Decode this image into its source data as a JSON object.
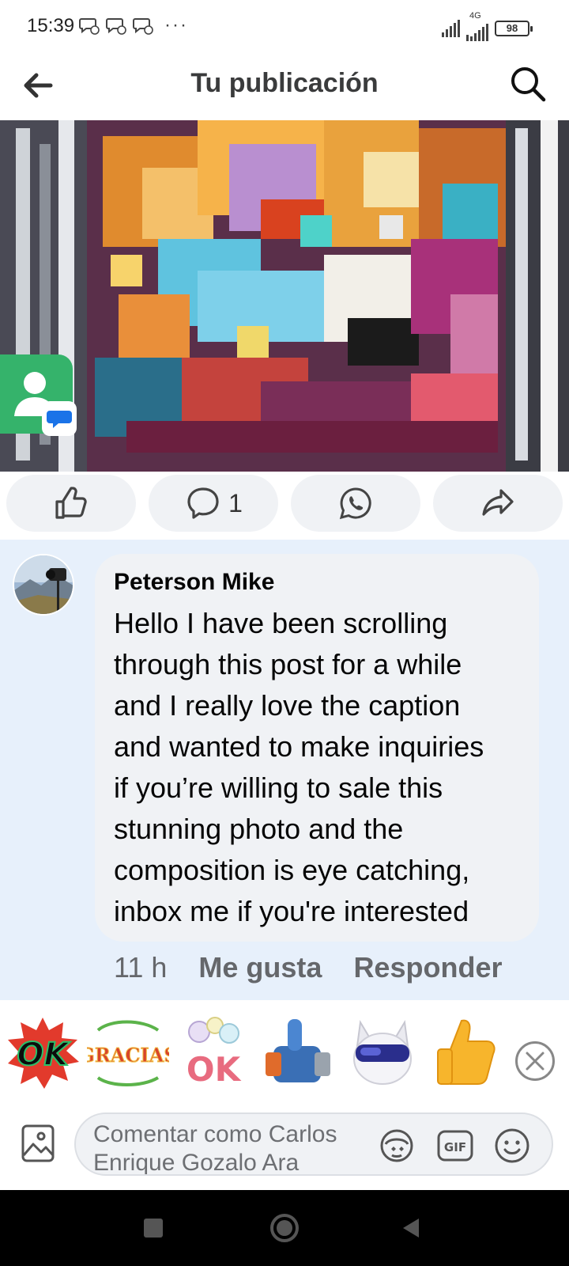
{
  "status_bar": {
    "time": "15:39",
    "more": "···",
    "network": "4G",
    "battery": "98"
  },
  "header": {
    "title": "Tu publicación"
  },
  "post_actions": {
    "comment_count": "1"
  },
  "comment": {
    "author": "Peterson Mike",
    "text": "Hello I have been scrolling\nthrough this post for a while\nand I really love the caption\nand wanted to make inquiries\nif you’re willing to sale this\nstunning photo and the\ncomposition is eye catching,\ninbox me if you're interested",
    "time": "11 h",
    "like_label": "Me gusta",
    "reply_label": "Responder"
  },
  "stickers": [
    {
      "name": "ok-sticker",
      "text": "OK"
    },
    {
      "name": "gracias-sticker",
      "text": "GRACIAS"
    },
    {
      "name": "cute-ok-sticker",
      "text": "OK"
    },
    {
      "name": "robot-thumbs-sticker",
      "text": ""
    },
    {
      "name": "cat-sunglasses-sticker",
      "text": ""
    },
    {
      "name": "thumbs-up-sticker",
      "text": ""
    }
  ],
  "comment_input": {
    "placeholder": "Comentar como Carlos Enrique Gozalo Ara"
  },
  "colors": {
    "accent_blue": "#1877f2",
    "comment_highlight": "#e7f0fb",
    "bubble_bg": "#f0f2f5",
    "meta_gray": "#65676b"
  }
}
